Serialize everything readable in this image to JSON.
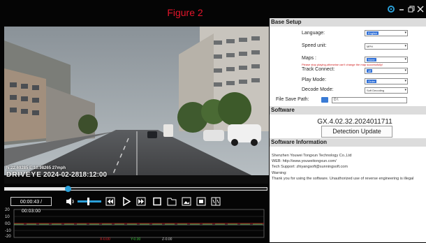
{
  "window": {
    "title": "Figure 2",
    "accent": "#2ba0d8"
  },
  "video": {
    "coords": "N:22.69285   E:10.98265   27mph",
    "brand": "DRIVEYE",
    "date": "2024-02-28",
    "time": "18:12:00"
  },
  "playback": {
    "progress": 0.24,
    "time_display": "00:00:43 / 00:03:00",
    "volume": 0.4
  },
  "graph": {
    "y_labels": [
      "20",
      "10",
      "0G",
      "-10",
      "-20"
    ],
    "legend": [
      {
        "label": "X-0.00",
        "color": "#e8262d"
      },
      {
        "label": "Y-0.00",
        "color": "#3cbf3c"
      },
      {
        "label": "Z-0.00",
        "color": "#c9c9c9"
      }
    ]
  },
  "base_setup": {
    "header": "Base Setup",
    "language": {
      "label": "Language:",
      "value": "English"
    },
    "speed_unit": {
      "label": "Speed unit:",
      "value": "MPH"
    },
    "maps": {
      "label": "Maps :",
      "value": "None",
      "warning": "Please stop playing,otherwise can't change the map successfully!"
    },
    "track_connect": {
      "label": "Track Connect:",
      "value": "off"
    },
    "play_mode": {
      "label": "Play Mode:",
      "value": "Order"
    },
    "decode_mode": {
      "label": "Decode Mode:",
      "value": "Soft Decoding"
    },
    "file_save_path": {
      "label": "File Save Path:",
      "value": "D:\\"
    }
  },
  "software": {
    "header": "Software",
    "version": "GX.4.02.32.2024011711",
    "detect_button": "Detection Update"
  },
  "software_information": {
    "header": "Software Information",
    "lines": [
      "Shenzhen Youwei Tongxun Technology Co.,Ltd",
      "WEB: http://www.youweitongxun.com/",
      "Tech Support: zhiyangsoft@sunningsoft.com",
      "Warning:",
      "Thank you for using the software. Unauthorized use of reverse engineering is illegal"
    ]
  },
  "icons": [
    "settings-gear-icon",
    "minimize-icon",
    "restore-icon",
    "close-icon",
    "volume-icon",
    "prev-icon",
    "play-icon",
    "next-icon",
    "stop-icon",
    "folder-icon",
    "snapshot-icon",
    "fullscreen-icon",
    "split-view-icon"
  ]
}
